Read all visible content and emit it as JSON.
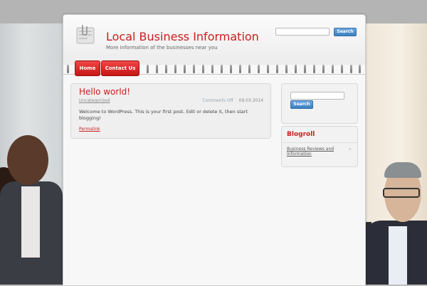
{
  "site": {
    "title": "Local Business Information",
    "description": "More information of the businesses near you"
  },
  "header_search": {
    "button_label": "Search",
    "placeholder": ""
  },
  "nav": {
    "items": [
      {
        "label": "Home"
      },
      {
        "label": "Contact Us"
      }
    ]
  },
  "post": {
    "title": "Hello world!",
    "category": "Uncategorized",
    "comments": "Comments Off",
    "date": "09.03.2014",
    "body": "Welcome to WordPress. This is your first post. Edit or delete it, then start blogging!",
    "permalink": "Permalink"
  },
  "sidebar": {
    "search_button": "Search",
    "blogroll_title": "Blogroll",
    "blogroll_links": [
      {
        "label": "Business Reviews and Information"
      }
    ],
    "blogroll_arrow": "»"
  },
  "colors": {
    "accent_red": "#c91e1e",
    "nav_red": "#e03030",
    "search_blue": "#4a8ccf"
  },
  "icons": {
    "logo": "paper-clip-note-icon"
  }
}
